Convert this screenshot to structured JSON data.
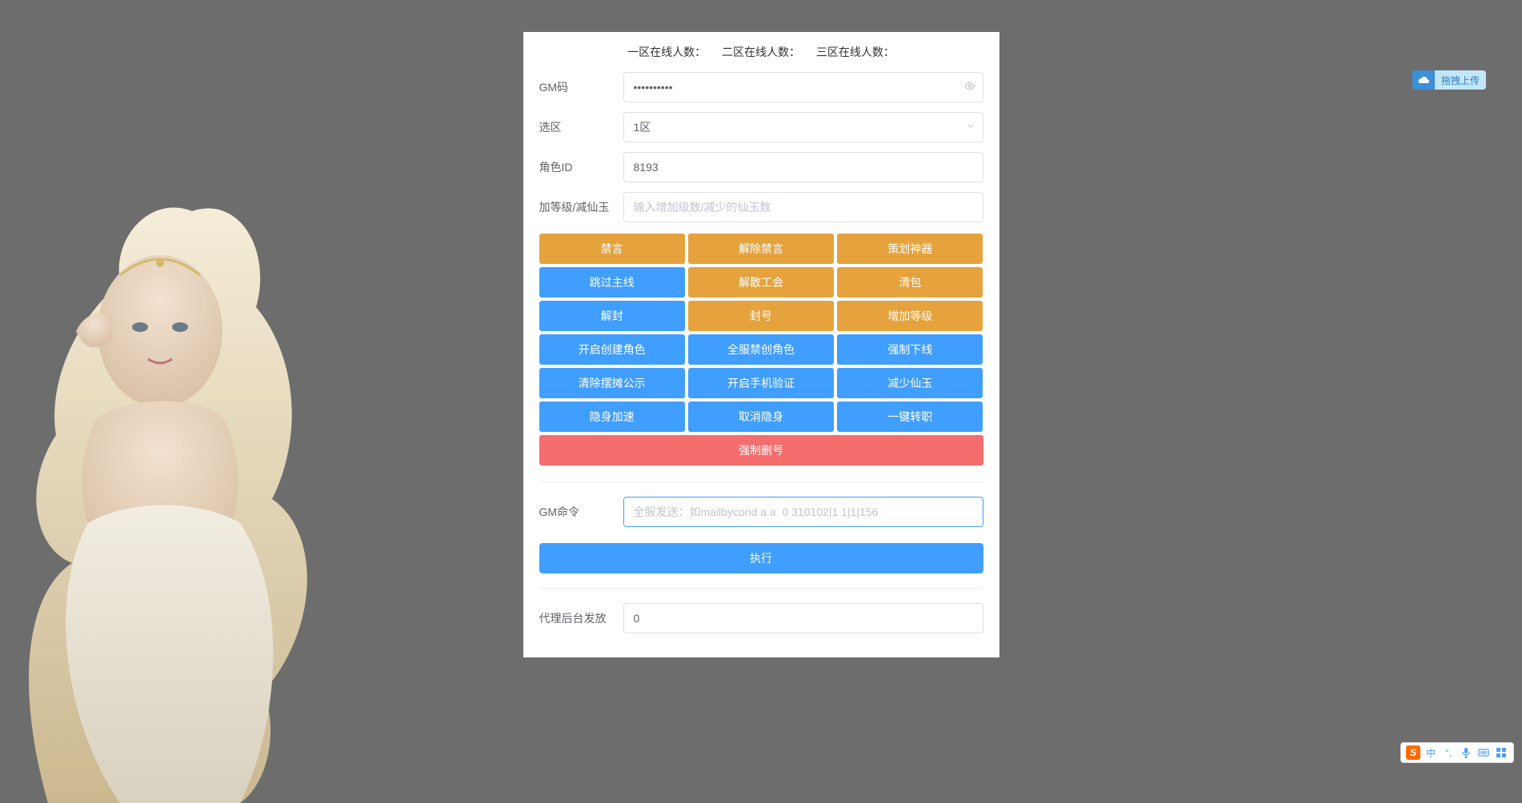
{
  "header": {
    "zone1": "一区在线人数：",
    "zone2": "二区在线人数：",
    "zone3": "三区在线人数："
  },
  "form": {
    "gm_code_label": "GM码",
    "gm_code_value": "••••••••••",
    "zone_label": "选区",
    "zone_value": "1区",
    "role_id_label": "角色ID",
    "role_id_value": "8193",
    "level_label": "加等级/减仙玉",
    "level_placeholder": "输入增加级数/减少的仙玉数"
  },
  "buttons": {
    "r1c1": "禁言",
    "r1c2": "解除禁言",
    "r1c3": "策划神器",
    "r2c1": "跳过主线",
    "r2c2": "解散工会",
    "r2c3": "清包",
    "r3c1": "解封",
    "r3c2": "封号",
    "r3c3": "增加等级",
    "r4c1": "开启创建角色",
    "r4c2": "全服禁创角色",
    "r4c3": "强制下线",
    "r5c1": "清除摆摊公示",
    "r5c2": "开启手机验证",
    "r5c3": "减少仙玉",
    "r6c1": "隐身加速",
    "r6c2": "取消隐身",
    "r6c3": "一键转职",
    "r7": "强制删号"
  },
  "gm_command": {
    "label": "GM命令",
    "placeholder": "全服发送：如mailbycond a a  0 310102|1 1|1|156"
  },
  "execute_label": "执行",
  "agent": {
    "label": "代理后台发放",
    "value": "0"
  },
  "upload_badge": "拖拽上传",
  "ime": {
    "lang": "中"
  }
}
